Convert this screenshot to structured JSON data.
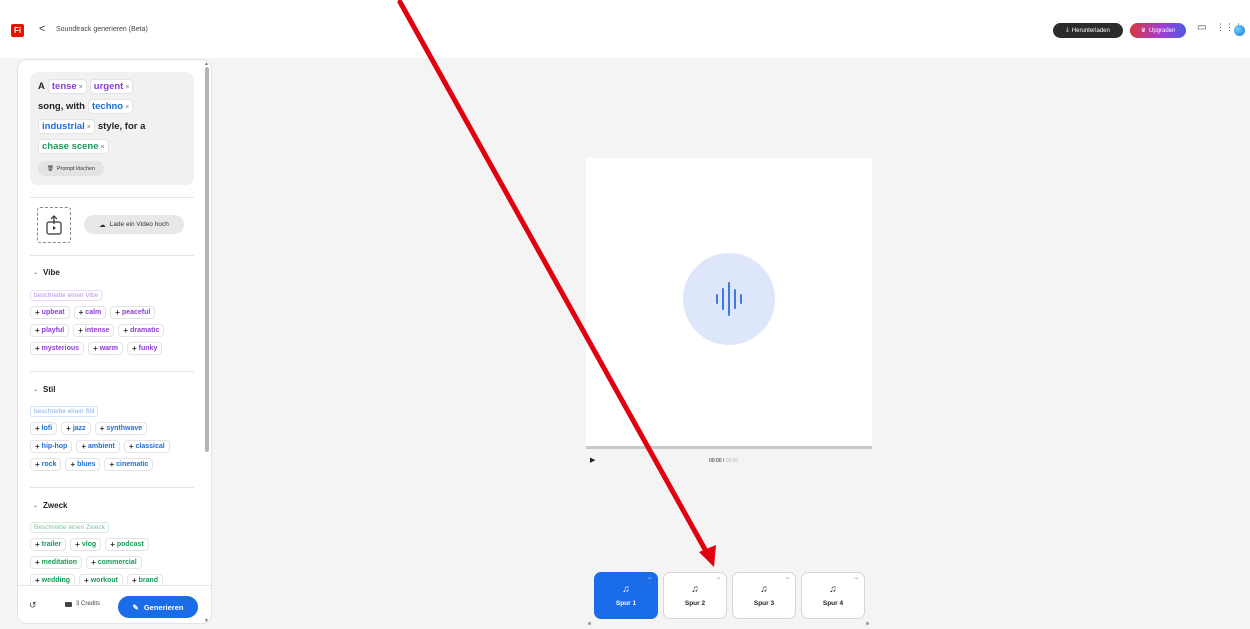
{
  "header": {
    "logo": "Fi",
    "back": "<",
    "title": "Soundtrack generieren (Beta)",
    "download_label": "Herunterladen",
    "upgrade_label": "Upgraden"
  },
  "prompt": {
    "word_a": "A",
    "tokens": {
      "tense": "tense",
      "urgent": "urgent",
      "techno": "techno",
      "industrial": "industrial",
      "chase": "chase scene"
    },
    "text_song_with": "song, with",
    "text_style_for": "style, for a",
    "token_close": "×",
    "clear_label": "Prompt löschen"
  },
  "upload": {
    "video_label": "Lade ein Video hoch"
  },
  "sections": {
    "vibe": {
      "title": "Vibe",
      "placeholder": "beschreibe einen Vibe",
      "rows": [
        [
          "upbeat",
          "calm",
          "peaceful"
        ],
        [
          "playful",
          "intense",
          "dramatic"
        ],
        [
          "mysterious",
          "warm",
          "funky"
        ]
      ]
    },
    "style": {
      "title": "Stil",
      "placeholder": "beschreibe einen Stil",
      "rows": [
        [
          "lofi",
          "jazz",
          "synthwave"
        ],
        [
          "hip-hop",
          "ambient",
          "classical"
        ],
        [
          "rock",
          "blues",
          "cinematic"
        ]
      ]
    },
    "purpose": {
      "title": "Zweck",
      "placeholder": "Beschreibe einen Zweck",
      "rows": [
        [
          "trailer",
          "vlog",
          "podcast"
        ],
        [
          "meditation",
          "commercial"
        ],
        [
          "wedding",
          "workout",
          "brand"
        ]
      ]
    }
  },
  "footer": {
    "credits": "3 Credits",
    "generate_label": "Generieren"
  },
  "player": {
    "current_time": "00:00 /",
    "duration": "00:00"
  },
  "tracks": [
    {
      "label": "Spur 1",
      "active": true
    },
    {
      "label": "Spur 2",
      "active": false
    },
    {
      "label": "Spur 3",
      "active": false
    },
    {
      "label": "Spur 4",
      "active": false
    }
  ],
  "colors": {
    "accent": "#1b6ce8",
    "vibe": "#8b3dd6",
    "style": "#1a6fd9",
    "purpose": "#179a5a",
    "annotation_arrow": "#e0000f"
  }
}
